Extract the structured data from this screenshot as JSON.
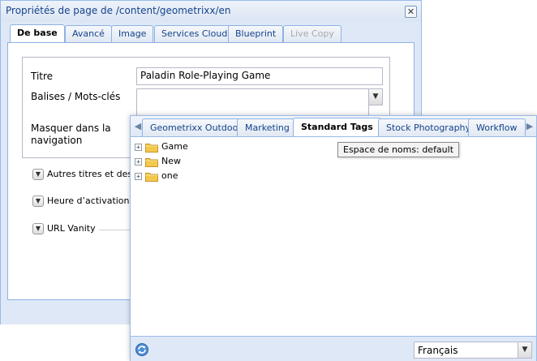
{
  "dialog": {
    "title": "Propriétés de page de /content/geometrixx/en",
    "close_glyph": "✕",
    "tabs": [
      {
        "label": "De base",
        "state": "active"
      },
      {
        "label": "Avancé",
        "state": "normal"
      },
      {
        "label": "Image",
        "state": "normal"
      },
      {
        "label": "Services Cloud",
        "state": "normal"
      },
      {
        "label": "Blueprint",
        "state": "normal"
      },
      {
        "label": "Live Copy",
        "state": "disabled"
      }
    ],
    "fields": {
      "title_label": "Titre",
      "title_value": "Paladin Role-Playing Game",
      "tags_label": "Balises / Mots-clés",
      "tags_value": "",
      "hide_label": "Masquer dans la navigation"
    },
    "sections": [
      {
        "label": "Autres titres et descr"
      },
      {
        "label": "Heure d’activation / d"
      },
      {
        "label": "URL Vanity"
      }
    ],
    "combo_glyph": "▼",
    "toggle_glyph": "▼"
  },
  "tag_picker": {
    "tabs": [
      {
        "label": "Geometrixx Outdoors",
        "state": "normal"
      },
      {
        "label": "Marketing",
        "state": "normal"
      },
      {
        "label": "Standard Tags",
        "state": "active"
      },
      {
        "label": "Stock Photography",
        "state": "normal"
      },
      {
        "label": "Workflow",
        "state": "normal"
      }
    ],
    "scroll_left_glyph": "◀",
    "scroll_right_glyph": "▶",
    "tree": [
      {
        "label": "Game"
      },
      {
        "label": "New"
      },
      {
        "label": "one"
      }
    ],
    "expand_glyph": "+",
    "tooltip": "Espace de noms: default",
    "language": "Français",
    "language_arrow": "▼"
  },
  "colors": {
    "accent": "#15428b",
    "border": "#99bbe8",
    "panel": "#dfe8f6",
    "folder": "#f3c94c"
  },
  "icons": {
    "close": "close-icon",
    "combo": "chevron-down-icon",
    "folder": "folder-icon",
    "refresh": "refresh-icon",
    "expand": "plus-icon"
  }
}
